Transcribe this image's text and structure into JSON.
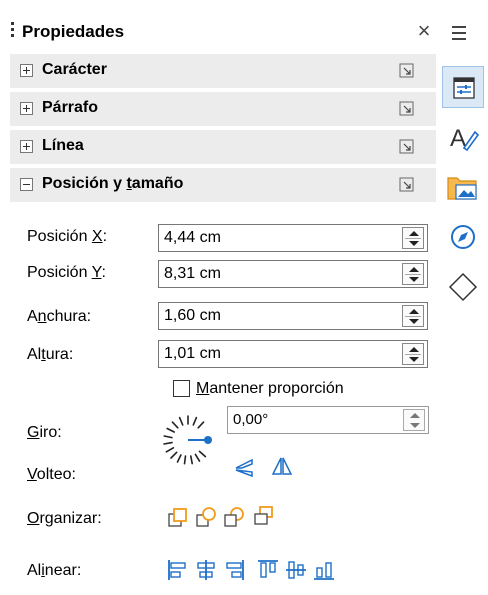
{
  "panel": {
    "title": "Propiedades",
    "close_glyph": "×"
  },
  "sections": {
    "character": {
      "label": "Carácter",
      "expanded": false
    },
    "paragraph": {
      "label": "Párrafo",
      "expanded": false
    },
    "line": {
      "label": "Línea",
      "expanded": false
    },
    "position_size": {
      "label_pre": "Posición y ",
      "label_u": "t",
      "label_post": "amaño",
      "expanded": true
    }
  },
  "position_size": {
    "pos_x": {
      "pre": "Posición ",
      "u": "X",
      "post": ":",
      "value": "4,44 cm"
    },
    "pos_y": {
      "pre": "Posición ",
      "u": "Y",
      "post": ":",
      "value": "8,31 cm"
    },
    "width": {
      "pre": "A",
      "u": "n",
      "post": "chura:",
      "value": "1,60 cm"
    },
    "height": {
      "pre": "Al",
      "u": "t",
      "post": "ura:",
      "value": "1,01 cm"
    },
    "keep_ratio": {
      "u": "M",
      "post": "antener proporción",
      "checked": false
    },
    "rotation": {
      "u": "G",
      "post": "iro:",
      "value": "0,00°"
    },
    "flip": {
      "u": "V",
      "post": "olteo:"
    },
    "arrange": {
      "u": "O",
      "post": "rganizar:"
    },
    "align": {
      "pre": "Al",
      "u": "i",
      "post": "near:"
    }
  },
  "sidebar_tabs": [
    {
      "name": "properties-icon",
      "selected": true
    },
    {
      "name": "styles-icon",
      "selected": false
    },
    {
      "name": "gallery-icon",
      "selected": false
    },
    {
      "name": "navigator-icon",
      "selected": false
    },
    {
      "name": "shapes-icon",
      "selected": false
    }
  ],
  "colors": {
    "accent_orange": "#f29b1d",
    "accent_blue": "#1e6fc8",
    "section_bg": "#ececec",
    "selected_tab_bg": "#dbe8f6"
  }
}
